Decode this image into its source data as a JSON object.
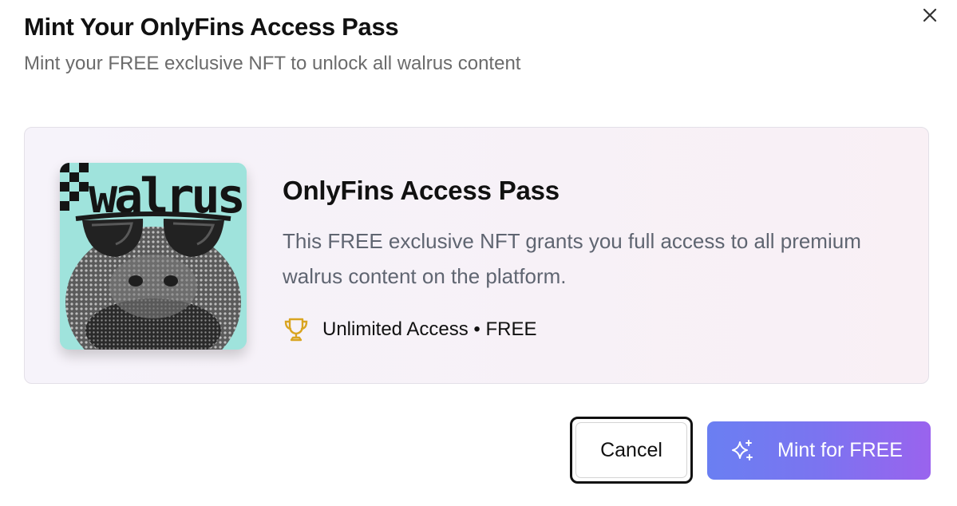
{
  "dialog": {
    "title": "Mint Your OnlyFins Access Pass",
    "subtitle": "Mint your FREE exclusive NFT to unlock all walrus content",
    "close_icon": "close-icon"
  },
  "nft": {
    "image_text": "walrus",
    "image_background": "#9fe3dc",
    "name": "OnlyFins Access Pass",
    "description": "This FREE exclusive NFT grants you full access to all premium walrus content on the platform.",
    "meta_icon": "trophy-icon",
    "meta_text": "Unlimited Access • FREE"
  },
  "actions": {
    "cancel_label": "Cancel",
    "mint_label": "Mint for FREE",
    "mint_icon": "sparkles-icon"
  },
  "colors": {
    "mint_gradient_start": "#6a7ff2",
    "mint_gradient_end": "#9a63ee",
    "trophy": "#d9a521"
  }
}
